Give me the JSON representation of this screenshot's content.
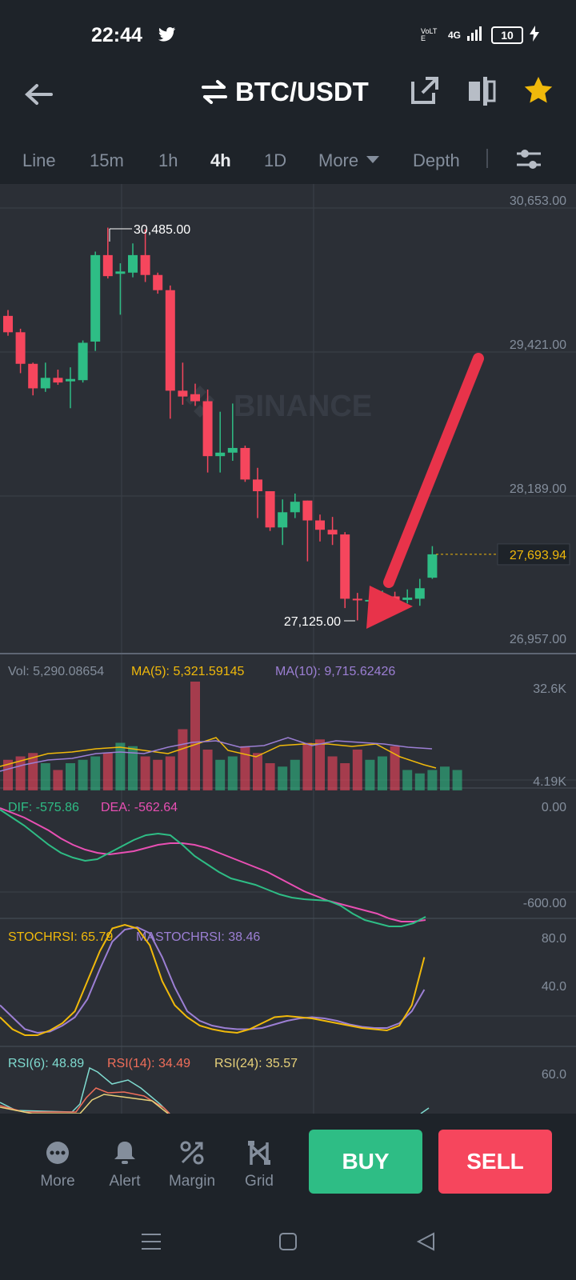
{
  "status": {
    "time": "22:44",
    "network": "4G",
    "lte": "VoLTE",
    "battery": "10"
  },
  "header": {
    "title": "BTC/USDT"
  },
  "tabs": [
    "Line",
    "15m",
    "1h",
    "4h",
    "1D",
    "More",
    "Depth"
  ],
  "active_tab": "4h",
  "chart_data": {
    "type": "candlestick",
    "watermark": "BINANCE",
    "price_axis": [
      "30,653.00",
      "29,421.00",
      "28,189.00",
      "26,957.00"
    ],
    "high_label": "30,485.00",
    "low_label": "27,125.00",
    "current_price": "27,693.94",
    "candles": [
      {
        "o": 29730,
        "h": 29780,
        "l": 29560,
        "c": 29590
      },
      {
        "o": 29590,
        "h": 29620,
        "l": 29240,
        "c": 29320
      },
      {
        "o": 29320,
        "h": 29330,
        "l": 29050,
        "c": 29110
      },
      {
        "o": 29110,
        "h": 29330,
        "l": 29080,
        "c": 29200
      },
      {
        "o": 29200,
        "h": 29270,
        "l": 29140,
        "c": 29160
      },
      {
        "o": 29170,
        "h": 29290,
        "l": 28940,
        "c": 29190
      },
      {
        "o": 29180,
        "h": 29520,
        "l": 29160,
        "c": 29500
      },
      {
        "o": 29510,
        "h": 30280,
        "l": 29430,
        "c": 30250
      },
      {
        "o": 30250,
        "h": 30485,
        "l": 30050,
        "c": 30070
      },
      {
        "o": 30090,
        "h": 30180,
        "l": 29740,
        "c": 30110
      },
      {
        "o": 30100,
        "h": 30350,
        "l": 30060,
        "c": 30250
      },
      {
        "o": 30250,
        "h": 30470,
        "l": 30020,
        "c": 30080
      },
      {
        "o": 30080,
        "h": 30100,
        "l": 29920,
        "c": 29950
      },
      {
        "o": 29950,
        "h": 29990,
        "l": 28850,
        "c": 29090
      },
      {
        "o": 29090,
        "h": 29330,
        "l": 28970,
        "c": 29040
      },
      {
        "o": 29060,
        "h": 29150,
        "l": 28960,
        "c": 29000
      },
      {
        "o": 29000,
        "h": 29100,
        "l": 28390,
        "c": 28530
      },
      {
        "o": 28530,
        "h": 28910,
        "l": 28390,
        "c": 28560
      },
      {
        "o": 28560,
        "h": 28980,
        "l": 28490,
        "c": 28600
      },
      {
        "o": 28600,
        "h": 28620,
        "l": 28310,
        "c": 28330
      },
      {
        "o": 28330,
        "h": 28430,
        "l": 28000,
        "c": 28230
      },
      {
        "o": 28230,
        "h": 28230,
        "l": 27890,
        "c": 27920
      },
      {
        "o": 27920,
        "h": 28160,
        "l": 27770,
        "c": 28050
      },
      {
        "o": 28050,
        "h": 28210,
        "l": 28000,
        "c": 28140
      },
      {
        "o": 28150,
        "h": 28150,
        "l": 27630,
        "c": 27980
      },
      {
        "o": 27980,
        "h": 28030,
        "l": 27800,
        "c": 27900
      },
      {
        "o": 27900,
        "h": 28010,
        "l": 27770,
        "c": 27860
      },
      {
        "o": 27860,
        "h": 27880,
        "l": 27230,
        "c": 27310
      },
      {
        "o": 27310,
        "h": 27360,
        "l": 27125,
        "c": 27300
      },
      {
        "o": 27290,
        "h": 27370,
        "l": 27170,
        "c": 27300
      },
      {
        "o": 27300,
        "h": 27380,
        "l": 27240,
        "c": 27340
      },
      {
        "o": 27330,
        "h": 27370,
        "l": 27240,
        "c": 27300
      },
      {
        "o": 27300,
        "h": 27390,
        "l": 27270,
        "c": 27320
      },
      {
        "o": 27310,
        "h": 27480,
        "l": 27250,
        "c": 27400
      },
      {
        "o": 27490,
        "h": 27760,
        "l": 27480,
        "c": 27690
      }
    ],
    "volume": {
      "label": "Vol: 5,290.08654",
      "ma5": "MA(5): 5,321.59145",
      "ma10": "MA(10): 9,715.62426",
      "axis_top": "32.6K",
      "axis_bottom": "4.19K",
      "values": [
        9,
        10,
        11,
        8,
        6,
        8,
        9,
        10,
        11,
        14,
        13,
        10,
        9,
        10,
        18,
        32,
        12,
        9,
        10,
        13,
        11,
        8,
        7,
        9,
        14,
        15,
        10,
        8,
        12,
        9,
        10,
        13,
        6,
        5,
        6,
        7,
        6
      ]
    },
    "macd": {
      "dif_label": "DIF: -575.86",
      "dea_label": "DEA: -562.64",
      "axis_top": "0.00",
      "axis_bottom": "-600.00",
      "dif": [
        -10,
        -60,
        -110,
        -170,
        -230,
        -280,
        -310,
        -330,
        -320,
        -280,
        -240,
        -200,
        -170,
        -160,
        -170,
        -230,
        -300,
        -350,
        -400,
        -440,
        -460,
        -480,
        -510,
        -540,
        -560,
        -570,
        -575,
        -580,
        -610,
        -660,
        -700,
        -720,
        -740,
        -740,
        -720,
        -680
      ],
      "dea": [
        0,
        -30,
        -60,
        -100,
        -140,
        -190,
        -230,
        -260,
        -280,
        -290,
        -280,
        -270,
        -250,
        -230,
        -220,
        -220,
        -230,
        -250,
        -280,
        -310,
        -340,
        -370,
        -400,
        -440,
        -480,
        -520,
        -550,
        -580,
        -600,
        -620,
        -640,
        -660,
        -690,
        -710,
        -710,
        -700
      ]
    },
    "stochrsi": {
      "k_label": "STOCHRSI: 65.79",
      "d_label": "MASTOCHRSI: 38.46",
      "axis": [
        "80.0",
        "40.0"
      ],
      "k": [
        15,
        5,
        0,
        0,
        4,
        10,
        20,
        45,
        70,
        89,
        92,
        89,
        75,
        45,
        25,
        15,
        8,
        5,
        3,
        2,
        5,
        10,
        15,
        16,
        15,
        14,
        12,
        10,
        8,
        6,
        5,
        4,
        8,
        25,
        65
      ],
      "d": [
        25,
        15,
        5,
        2,
        3,
        8,
        15,
        30,
        55,
        78,
        88,
        90,
        85,
        65,
        40,
        20,
        12,
        8,
        6,
        5,
        5,
        6,
        9,
        12,
        14,
        15,
        14,
        12,
        9,
        7,
        6,
        6,
        10,
        20,
        38
      ]
    },
    "rsi": {
      "rsi6_label": "RSI(6): 48.89",
      "rsi14_label": "RSI(14): 34.49",
      "rsi24_label": "RSI(24): 35.57",
      "axis": "60.0"
    }
  },
  "bottom_nav": {
    "items": [
      {
        "label": "More",
        "icon": "more-icon"
      },
      {
        "label": "Alert",
        "icon": "bell-icon"
      },
      {
        "label": "Margin",
        "icon": "margin-icon"
      },
      {
        "label": "Grid",
        "icon": "grid-icon"
      }
    ],
    "buy": "BUY",
    "sell": "SELL"
  },
  "colors": {
    "up": "#2ebd85",
    "down": "#f6465d",
    "accent": "#f0b90b",
    "arrow": "#e8334a"
  }
}
